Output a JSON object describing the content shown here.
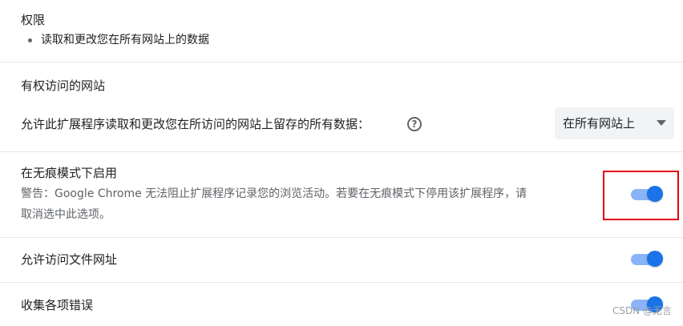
{
  "permissions": {
    "title": "权限",
    "items": [
      "读取和更改您在所有网站上的数据"
    ]
  },
  "site_access": {
    "title": "有权访问的网站",
    "description": "允许此扩展程序读取和更改您在所访问的网站上留存的所有数据：",
    "help_icon": "question-circle-icon",
    "select_value": "在所有网站上"
  },
  "incognito": {
    "title": "在无痕模式下启用",
    "warning_line1": "警告：Google Chrome 无法阻止扩展程序记录您的浏览活动。若要在无痕模式下停用该扩展程序，请",
    "warning_line2": "取消选中此选项。",
    "enabled": true
  },
  "file_urls": {
    "title": "允许访问文件网址",
    "enabled": true
  },
  "errors": {
    "title": "收集各项错误",
    "enabled": true
  },
  "colors": {
    "accent": "#1a73e8",
    "track": "#8ab4f8",
    "highlight": "#e60000"
  },
  "watermark": "CSDN @无言"
}
